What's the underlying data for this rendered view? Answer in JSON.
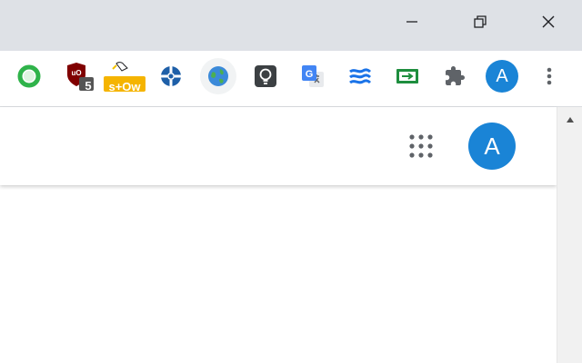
{
  "colors": {
    "titlebar_bg": "#dee1e6",
    "avatar_blue": "#1a84d6",
    "icon_gray": "#5f6368"
  },
  "window_controls": {
    "minimize_icon": "minimize-icon",
    "restore_icon": "restore-icon",
    "close_icon": "close-icon"
  },
  "toolbar": {
    "extensions": [
      {
        "name": "green-ring-extension-icon"
      },
      {
        "name": "ublock-origin-icon",
        "badge": "5"
      },
      {
        "name": "stow-extension-icon",
        "label": "s+Ow"
      },
      {
        "name": "blue-cross-extension-icon"
      },
      {
        "name": "globe-extension-icon"
      },
      {
        "name": "lightbulb-extension-icon"
      },
      {
        "name": "google-translate-icon"
      },
      {
        "name": "waves-extension-icon"
      },
      {
        "name": "green-arrow-extension-icon"
      },
      {
        "name": "puzzle-extensions-icon"
      }
    ],
    "profile_avatar_letter": "A",
    "menu_icon": "kebab-menu-icon"
  },
  "page_header": {
    "apps_icon": "google-apps-grid-icon",
    "avatar_letter": "A"
  },
  "scrollbar": {
    "up_arrow_icon": "scroll-up-arrow-icon"
  }
}
